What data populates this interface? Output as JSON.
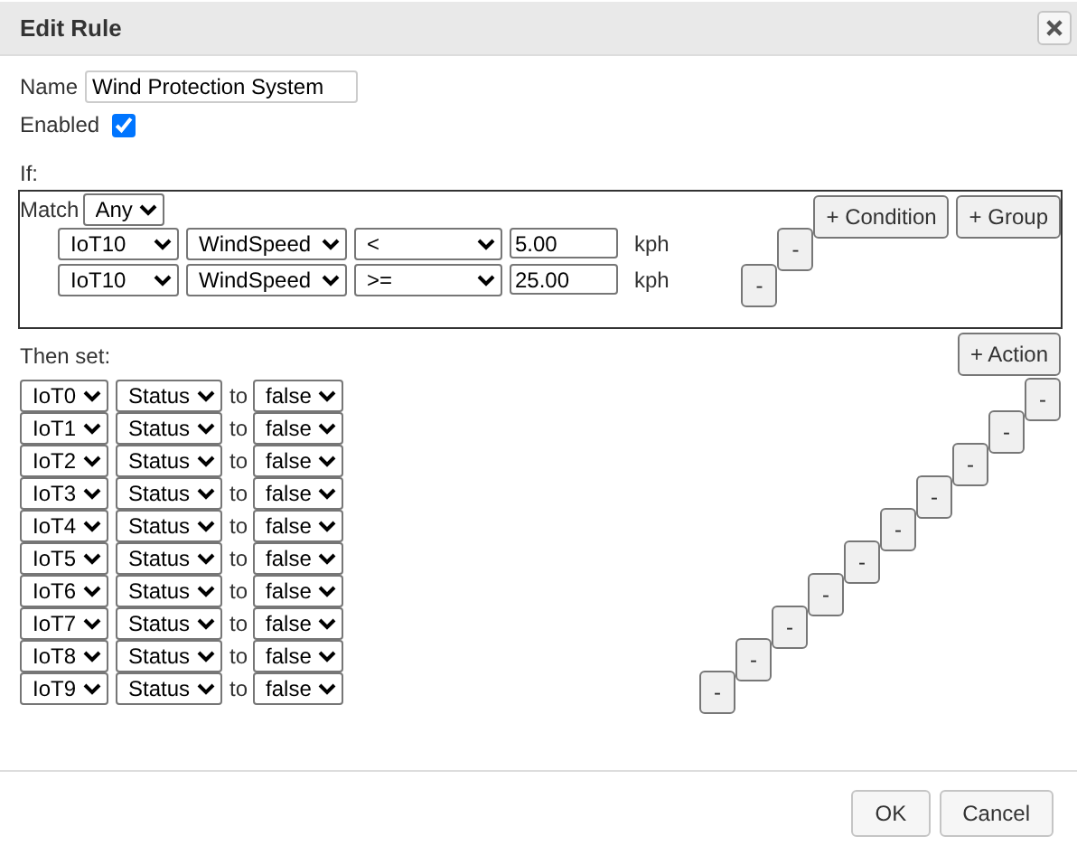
{
  "dialog": {
    "title": "Edit Rule"
  },
  "name": {
    "label": "Name",
    "value": "Wind Protection System"
  },
  "enabled": {
    "label": "Enabled",
    "checked": true
  },
  "if_section": {
    "label": "If:",
    "match_label": "Match",
    "match_value": "Any",
    "buttons": [
      "+ Condition",
      "+ Group"
    ],
    "conditions": [
      {
        "device": "IoT10",
        "property": "WindSpeed",
        "operator": "<",
        "value": "5.00",
        "unit": "kph",
        "remove": "-"
      },
      {
        "device": "IoT10",
        "property": "WindSpeed",
        "operator": ">=",
        "value": "25.00",
        "unit": "kph",
        "remove": "-"
      }
    ]
  },
  "then_section": {
    "label": "Then set:",
    "add_button": "+ Action",
    "actions": [
      {
        "device": "IoT0",
        "property": "Status",
        "connector": "to",
        "value": "false",
        "remove": "-"
      },
      {
        "device": "IoT1",
        "property": "Status",
        "connector": "to",
        "value": "false",
        "remove": "-"
      },
      {
        "device": "IoT2",
        "property": "Status",
        "connector": "to",
        "value": "false",
        "remove": "-"
      },
      {
        "device": "IoT3",
        "property": "Status",
        "connector": "to",
        "value": "false",
        "remove": "-"
      },
      {
        "device": "IoT4",
        "property": "Status",
        "connector": "to",
        "value": "false",
        "remove": "-"
      },
      {
        "device": "IoT5",
        "property": "Status",
        "connector": "to",
        "value": "false",
        "remove": "-"
      },
      {
        "device": "IoT6",
        "property": "Status",
        "connector": "to",
        "value": "false",
        "remove": "-"
      },
      {
        "device": "IoT7",
        "property": "Status",
        "connector": "to",
        "value": "false",
        "remove": "-"
      },
      {
        "device": "IoT8",
        "property": "Status",
        "connector": "to",
        "value": "false",
        "remove": "-"
      },
      {
        "device": "IoT9",
        "property": "Status",
        "connector": "to",
        "value": "false",
        "remove": "-"
      }
    ]
  },
  "footer": {
    "buttons": [
      "OK",
      "Cancel"
    ]
  }
}
